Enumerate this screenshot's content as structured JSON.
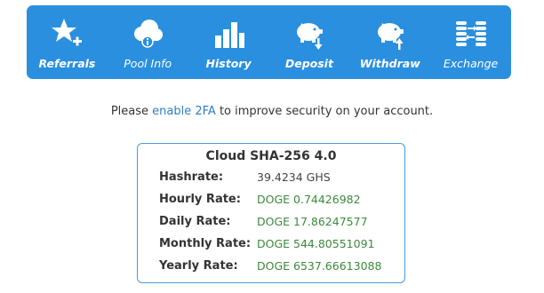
{
  "nav": {
    "items": [
      {
        "label": "Referrals",
        "icon": "star-plus-icon"
      },
      {
        "label": "Pool Info",
        "icon": "cloud-info-icon"
      },
      {
        "label": "History",
        "icon": "bar-chart-icon"
      },
      {
        "label": "Deposit",
        "icon": "piggy-bank-deposit-icon"
      },
      {
        "label": "Withdraw",
        "icon": "piggy-bank-withdraw-icon"
      },
      {
        "label": "Exchange",
        "icon": "coin-stacks-exchange-icon"
      }
    ]
  },
  "notice": {
    "before": "Please",
    "link": "enable 2FA",
    "after": "to improve security on your account."
  },
  "card": {
    "title": "Cloud SHA-256 4.0",
    "rows": [
      {
        "label": "Hashrate:",
        "value": "39.4234 GHS"
      },
      {
        "label": "Hourly Rate:",
        "value": "DOGE 0.74426982"
      },
      {
        "label": "Daily Rate:",
        "value": "DOGE 17.86247577"
      },
      {
        "label": "Monthly Rate:",
        "value": "DOGE 544.80551091"
      },
      {
        "label": "Yearly Rate:",
        "value": "DOGE 6537.66613088"
      }
    ]
  },
  "colors": {
    "accent": "#2a8fde",
    "link": "#2a7fc8",
    "rate": "#3b8a3b"
  }
}
